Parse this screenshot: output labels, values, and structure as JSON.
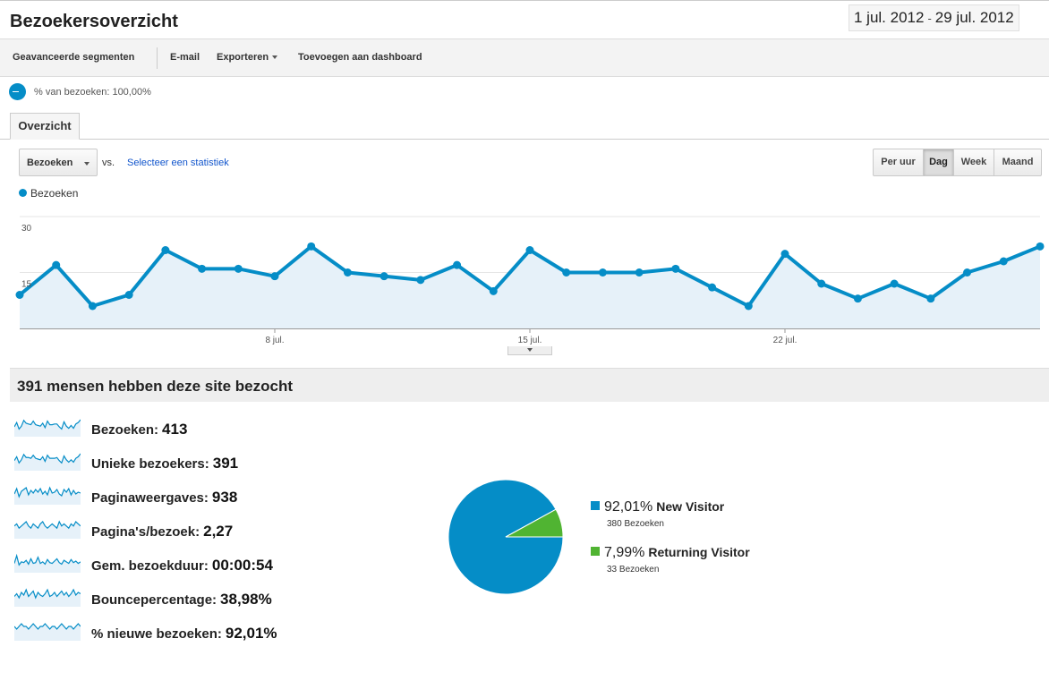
{
  "header": {
    "title": "Bezoekersoverzicht",
    "date_start": "1 jul. 2012",
    "date_sep": "-",
    "date_end": "29 jul. 2012"
  },
  "toolbar": {
    "advanced_segments": "Geavanceerde segmenten",
    "email": "E-mail",
    "export": "Exporteren",
    "add_to_dashboard": "Toevoegen aan dashboard"
  },
  "segment": {
    "text": "% van bezoeken: 100,00%",
    "color": "#058dc7"
  },
  "tabs": {
    "overview": "Overzicht"
  },
  "controls": {
    "metric_select": "Bezoeken",
    "vs": "vs.",
    "select_stat": "Selecteer een statistiek",
    "periods": [
      "Per uur",
      "Dag",
      "Week",
      "Maand"
    ],
    "active_period": "Dag"
  },
  "chart_data": {
    "type": "area",
    "x": [
      "1 jul.",
      "2 jul.",
      "3 jul.",
      "4 jul.",
      "5 jul.",
      "6 jul.",
      "7 jul.",
      "8 jul.",
      "9 jul.",
      "10 jul.",
      "11 jul.",
      "12 jul.",
      "13 jul.",
      "14 jul.",
      "15 jul.",
      "16 jul.",
      "17 jul.",
      "18 jul.",
      "19 jul.",
      "20 jul.",
      "21 jul.",
      "22 jul.",
      "23 jul.",
      "24 jul.",
      "25 jul.",
      "26 jul.",
      "27 jul.",
      "28 jul.",
      "29 jul."
    ],
    "series": [
      {
        "name": "Bezoeken",
        "values": [
          9,
          17,
          6,
          9,
          21,
          16,
          16,
          14,
          22,
          15,
          14,
          13,
          17,
          10,
          21,
          15,
          15,
          15,
          16,
          11,
          6,
          20,
          12,
          8,
          12,
          8,
          15,
          18,
          22
        ],
        "color": "#058dc7"
      }
    ],
    "x_tick_labels": [
      "8 jul.",
      "15 jul.",
      "22 jul."
    ],
    "y_tick_labels": [
      "30",
      "15"
    ],
    "ylim": [
      0,
      30
    ],
    "grid": true,
    "legend": "top-left"
  },
  "summary": {
    "title": "391 mensen hebben deze site bezocht"
  },
  "metrics": [
    {
      "label": "Bezoeken:",
      "value": "413",
      "spark": [
        8,
        14,
        5,
        9,
        17,
        13,
        12,
        11,
        16,
        11,
        10,
        9,
        13,
        7,
        16,
        11,
        11,
        12,
        12,
        8,
        5,
        15,
        9,
        6,
        10,
        6,
        12,
        14,
        18
      ]
    },
    {
      "label": "Unieke bezoekers:",
      "value": "391",
      "spark": [
        8,
        13,
        5,
        9,
        16,
        12,
        12,
        11,
        15,
        11,
        10,
        9,
        13,
        7,
        15,
        11,
        11,
        11,
        12,
        8,
        5,
        14,
        9,
        6,
        9,
        6,
        11,
        13,
        17
      ]
    },
    {
      "label": "Paginaweergaves:",
      "value": "938",
      "spark": [
        10,
        16,
        7,
        13,
        15,
        17,
        9,
        14,
        11,
        15,
        12,
        16,
        10,
        13,
        9,
        17,
        11,
        12,
        15,
        10,
        8,
        15,
        12,
        16,
        9,
        14,
        10,
        12,
        11
      ]
    },
    {
      "label": "Pagina's/bezoek:",
      "value": "2,27",
      "spark": [
        12,
        13,
        11,
        12,
        13,
        14,
        12,
        11,
        13,
        12,
        11,
        13,
        14,
        12,
        11,
        12,
        13,
        12,
        11,
        14,
        12,
        13,
        12,
        11,
        13,
        12,
        14,
        13,
        12
      ]
    },
    {
      "label": "Gem. bezoekduur:",
      "value": "00:00:54",
      "spark": [
        8,
        18,
        6,
        10,
        9,
        12,
        7,
        14,
        8,
        9,
        16,
        8,
        10,
        7,
        13,
        9,
        8,
        11,
        14,
        9,
        7,
        12,
        10,
        8,
        13,
        9,
        11,
        8,
        10
      ]
    },
    {
      "label": "Bouncepercentage:",
      "value": "38,98%",
      "spark": [
        9,
        11,
        8,
        12,
        10,
        14,
        9,
        11,
        13,
        8,
        12,
        10,
        9,
        11,
        14,
        9,
        10,
        12,
        9,
        11,
        13,
        10,
        12,
        9,
        11,
        14,
        10,
        12,
        11
      ]
    },
    {
      "label": "% nieuwe bezoeken:",
      "value": "92,01%",
      "spark": [
        13,
        12,
        13,
        14,
        13,
        13,
        12,
        13,
        14,
        13,
        12,
        13,
        13,
        14,
        13,
        12,
        13,
        13,
        12,
        13,
        14,
        13,
        12,
        13,
        13,
        12,
        13,
        14,
        13
      ]
    }
  ],
  "pie": {
    "slices": [
      {
        "name": "New Visitor",
        "percent": "92,01%",
        "value": 92.01,
        "sub": "380 Bezoeken",
        "color": "#058dc7"
      },
      {
        "name": "Returning Visitor",
        "percent": "7,99%",
        "value": 7.99,
        "sub": "33 Bezoeken",
        "color": "#50b432"
      }
    ]
  }
}
